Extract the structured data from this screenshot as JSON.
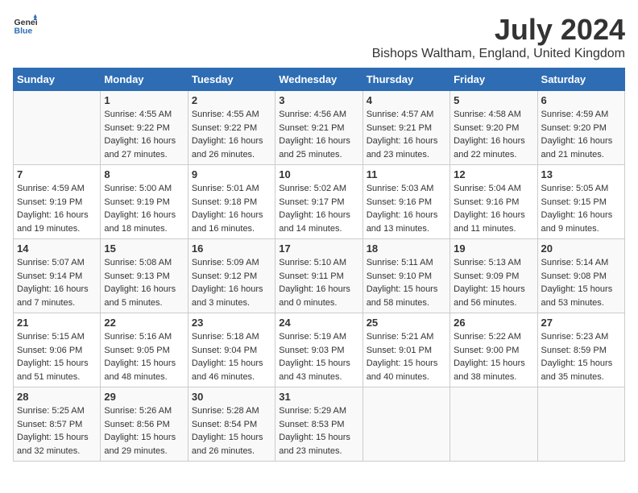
{
  "logo": {
    "general": "General",
    "blue": "Blue"
  },
  "title": "July 2024",
  "subtitle": "Bishops Waltham, England, United Kingdom",
  "headers": [
    "Sunday",
    "Monday",
    "Tuesday",
    "Wednesday",
    "Thursday",
    "Friday",
    "Saturday"
  ],
  "weeks": [
    [
      {
        "day": "",
        "sunrise": "",
        "sunset": "",
        "daylight": ""
      },
      {
        "day": "1",
        "sunrise": "Sunrise: 4:55 AM",
        "sunset": "Sunset: 9:22 PM",
        "daylight": "Daylight: 16 hours and 27 minutes."
      },
      {
        "day": "2",
        "sunrise": "Sunrise: 4:55 AM",
        "sunset": "Sunset: 9:22 PM",
        "daylight": "Daylight: 16 hours and 26 minutes."
      },
      {
        "day": "3",
        "sunrise": "Sunrise: 4:56 AM",
        "sunset": "Sunset: 9:21 PM",
        "daylight": "Daylight: 16 hours and 25 minutes."
      },
      {
        "day": "4",
        "sunrise": "Sunrise: 4:57 AM",
        "sunset": "Sunset: 9:21 PM",
        "daylight": "Daylight: 16 hours and 23 minutes."
      },
      {
        "day": "5",
        "sunrise": "Sunrise: 4:58 AM",
        "sunset": "Sunset: 9:20 PM",
        "daylight": "Daylight: 16 hours and 22 minutes."
      },
      {
        "day": "6",
        "sunrise": "Sunrise: 4:59 AM",
        "sunset": "Sunset: 9:20 PM",
        "daylight": "Daylight: 16 hours and 21 minutes."
      }
    ],
    [
      {
        "day": "7",
        "sunrise": "Sunrise: 4:59 AM",
        "sunset": "Sunset: 9:19 PM",
        "daylight": "Daylight: 16 hours and 19 minutes."
      },
      {
        "day": "8",
        "sunrise": "Sunrise: 5:00 AM",
        "sunset": "Sunset: 9:19 PM",
        "daylight": "Daylight: 16 hours and 18 minutes."
      },
      {
        "day": "9",
        "sunrise": "Sunrise: 5:01 AM",
        "sunset": "Sunset: 9:18 PM",
        "daylight": "Daylight: 16 hours and 16 minutes."
      },
      {
        "day": "10",
        "sunrise": "Sunrise: 5:02 AM",
        "sunset": "Sunset: 9:17 PM",
        "daylight": "Daylight: 16 hours and 14 minutes."
      },
      {
        "day": "11",
        "sunrise": "Sunrise: 5:03 AM",
        "sunset": "Sunset: 9:16 PM",
        "daylight": "Daylight: 16 hours and 13 minutes."
      },
      {
        "day": "12",
        "sunrise": "Sunrise: 5:04 AM",
        "sunset": "Sunset: 9:16 PM",
        "daylight": "Daylight: 16 hours and 11 minutes."
      },
      {
        "day": "13",
        "sunrise": "Sunrise: 5:05 AM",
        "sunset": "Sunset: 9:15 PM",
        "daylight": "Daylight: 16 hours and 9 minutes."
      }
    ],
    [
      {
        "day": "14",
        "sunrise": "Sunrise: 5:07 AM",
        "sunset": "Sunset: 9:14 PM",
        "daylight": "Daylight: 16 hours and 7 minutes."
      },
      {
        "day": "15",
        "sunrise": "Sunrise: 5:08 AM",
        "sunset": "Sunset: 9:13 PM",
        "daylight": "Daylight: 16 hours and 5 minutes."
      },
      {
        "day": "16",
        "sunrise": "Sunrise: 5:09 AM",
        "sunset": "Sunset: 9:12 PM",
        "daylight": "Daylight: 16 hours and 3 minutes."
      },
      {
        "day": "17",
        "sunrise": "Sunrise: 5:10 AM",
        "sunset": "Sunset: 9:11 PM",
        "daylight": "Daylight: 16 hours and 0 minutes."
      },
      {
        "day": "18",
        "sunrise": "Sunrise: 5:11 AM",
        "sunset": "Sunset: 9:10 PM",
        "daylight": "Daylight: 15 hours and 58 minutes."
      },
      {
        "day": "19",
        "sunrise": "Sunrise: 5:13 AM",
        "sunset": "Sunset: 9:09 PM",
        "daylight": "Daylight: 15 hours and 56 minutes."
      },
      {
        "day": "20",
        "sunrise": "Sunrise: 5:14 AM",
        "sunset": "Sunset: 9:08 PM",
        "daylight": "Daylight: 15 hours and 53 minutes."
      }
    ],
    [
      {
        "day": "21",
        "sunrise": "Sunrise: 5:15 AM",
        "sunset": "Sunset: 9:06 PM",
        "daylight": "Daylight: 15 hours and 51 minutes."
      },
      {
        "day": "22",
        "sunrise": "Sunrise: 5:16 AM",
        "sunset": "Sunset: 9:05 PM",
        "daylight": "Daylight: 15 hours and 48 minutes."
      },
      {
        "day": "23",
        "sunrise": "Sunrise: 5:18 AM",
        "sunset": "Sunset: 9:04 PM",
        "daylight": "Daylight: 15 hours and 46 minutes."
      },
      {
        "day": "24",
        "sunrise": "Sunrise: 5:19 AM",
        "sunset": "Sunset: 9:03 PM",
        "daylight": "Daylight: 15 hours and 43 minutes."
      },
      {
        "day": "25",
        "sunrise": "Sunrise: 5:21 AM",
        "sunset": "Sunset: 9:01 PM",
        "daylight": "Daylight: 15 hours and 40 minutes."
      },
      {
        "day": "26",
        "sunrise": "Sunrise: 5:22 AM",
        "sunset": "Sunset: 9:00 PM",
        "daylight": "Daylight: 15 hours and 38 minutes."
      },
      {
        "day": "27",
        "sunrise": "Sunrise: 5:23 AM",
        "sunset": "Sunset: 8:59 PM",
        "daylight": "Daylight: 15 hours and 35 minutes."
      }
    ],
    [
      {
        "day": "28",
        "sunrise": "Sunrise: 5:25 AM",
        "sunset": "Sunset: 8:57 PM",
        "daylight": "Daylight: 15 hours and 32 minutes."
      },
      {
        "day": "29",
        "sunrise": "Sunrise: 5:26 AM",
        "sunset": "Sunset: 8:56 PM",
        "daylight": "Daylight: 15 hours and 29 minutes."
      },
      {
        "day": "30",
        "sunrise": "Sunrise: 5:28 AM",
        "sunset": "Sunset: 8:54 PM",
        "daylight": "Daylight: 15 hours and 26 minutes."
      },
      {
        "day": "31",
        "sunrise": "Sunrise: 5:29 AM",
        "sunset": "Sunset: 8:53 PM",
        "daylight": "Daylight: 15 hours and 23 minutes."
      },
      {
        "day": "",
        "sunrise": "",
        "sunset": "",
        "daylight": ""
      },
      {
        "day": "",
        "sunrise": "",
        "sunset": "",
        "daylight": ""
      },
      {
        "day": "",
        "sunrise": "",
        "sunset": "",
        "daylight": ""
      }
    ]
  ]
}
